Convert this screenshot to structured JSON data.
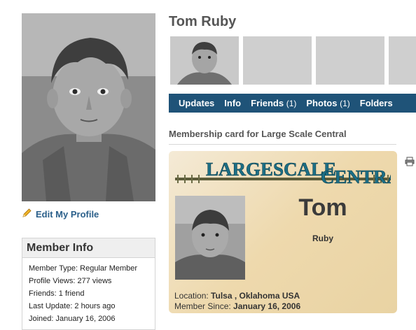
{
  "profile": {
    "name": "Tom Ruby",
    "edit_label": "Edit My Profile"
  },
  "member_info": {
    "heading": "Member Info",
    "lines": [
      "Member Type: Regular Member",
      "Profile Views: 277 views",
      "Friends: 1 friend",
      "Last Update: 2 hours ago",
      "Joined: January 16, 2006"
    ]
  },
  "tabs": [
    {
      "label": "Updates",
      "count": ""
    },
    {
      "label": "Info",
      "count": ""
    },
    {
      "label": "Friends",
      "count": "(1)"
    },
    {
      "label": "Photos",
      "count": "(1)"
    },
    {
      "label": "Folders",
      "count": ""
    }
  ],
  "card": {
    "section_title": "Membership card for Large Scale Central",
    "banner_text": "LargeScale Central",
    "first_name": "Tom",
    "last_name": "Ruby",
    "location_label": "Location:",
    "location_value": "Tulsa , Oklahoma USA",
    "since_label": "Member Since:",
    "since_value": "January 16, 2006"
  },
  "colors": {
    "tab_bar": "#1f5378",
    "link": "#2a5f8a",
    "banner_text": "#1c6f86",
    "card_bg": "#eed9ad"
  },
  "icons": [
    "pencil-icon",
    "printer-icon"
  ]
}
